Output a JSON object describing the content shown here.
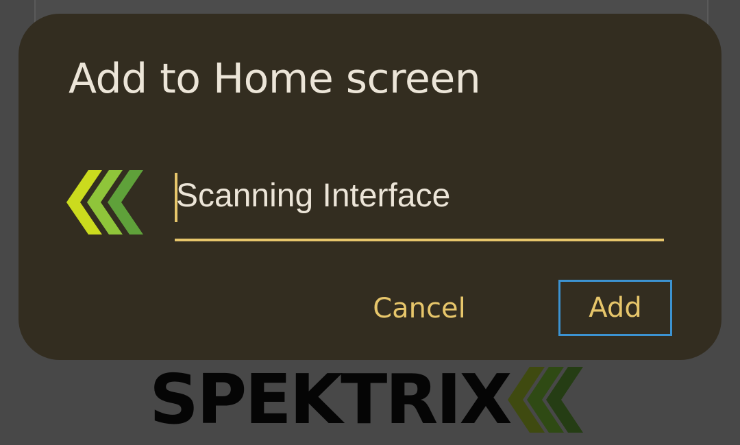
{
  "background": {
    "logo_text": "SPEKTRIX",
    "logo_icon": "spektrix-chevrons-icon"
  },
  "dialog": {
    "title": "Add to Home screen",
    "app_icon": "spektrix-chevrons-icon",
    "name_field": {
      "value": "Scanning Interface"
    },
    "cancel_label": "Cancel",
    "add_label": "Add"
  },
  "colors": {
    "dialog_background": "#332d20",
    "accent": "#e7c66b",
    "focus_outline": "#3c93d2",
    "text_primary": "#ece5d8",
    "scrim": "#484848",
    "logo_green_light": "#cbdb1e",
    "logo_green_mid": "#8fc53a",
    "logo_green_dark": "#5fa13a"
  }
}
